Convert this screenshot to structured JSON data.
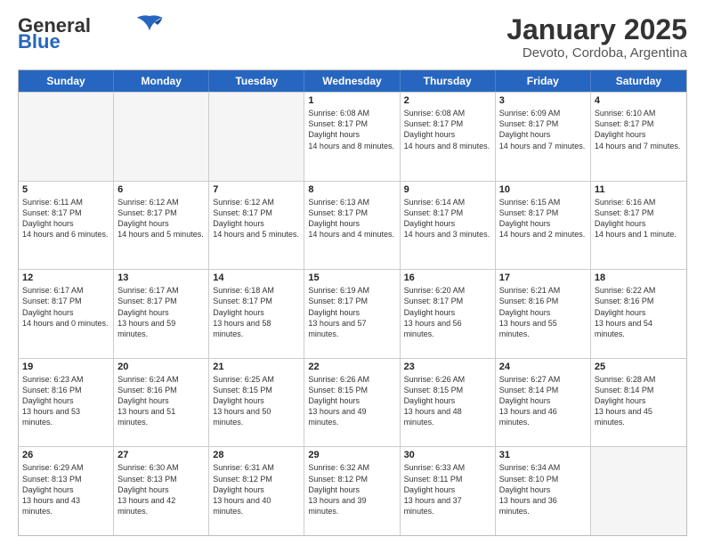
{
  "logo": {
    "text_general": "General",
    "text_blue": "Blue"
  },
  "title": "January 2025",
  "subtitle": "Devoto, Cordoba, Argentina",
  "weekdays": [
    "Sunday",
    "Monday",
    "Tuesday",
    "Wednesday",
    "Thursday",
    "Friday",
    "Saturday"
  ],
  "rows": [
    [
      {
        "day": "",
        "empty": true
      },
      {
        "day": "",
        "empty": true
      },
      {
        "day": "",
        "empty": true
      },
      {
        "day": "1",
        "sunrise": "6:08 AM",
        "sunset": "8:17 PM",
        "daylight": "14 hours and 8 minutes."
      },
      {
        "day": "2",
        "sunrise": "6:08 AM",
        "sunset": "8:17 PM",
        "daylight": "14 hours and 8 minutes."
      },
      {
        "day": "3",
        "sunrise": "6:09 AM",
        "sunset": "8:17 PM",
        "daylight": "14 hours and 7 minutes."
      },
      {
        "day": "4",
        "sunrise": "6:10 AM",
        "sunset": "8:17 PM",
        "daylight": "14 hours and 7 minutes."
      }
    ],
    [
      {
        "day": "5",
        "sunrise": "6:11 AM",
        "sunset": "8:17 PM",
        "daylight": "14 hours and 6 minutes."
      },
      {
        "day": "6",
        "sunrise": "6:12 AM",
        "sunset": "8:17 PM",
        "daylight": "14 hours and 5 minutes."
      },
      {
        "day": "7",
        "sunrise": "6:12 AM",
        "sunset": "8:17 PM",
        "daylight": "14 hours and 5 minutes."
      },
      {
        "day": "8",
        "sunrise": "6:13 AM",
        "sunset": "8:17 PM",
        "daylight": "14 hours and 4 minutes."
      },
      {
        "day": "9",
        "sunrise": "6:14 AM",
        "sunset": "8:17 PM",
        "daylight": "14 hours and 3 minutes."
      },
      {
        "day": "10",
        "sunrise": "6:15 AM",
        "sunset": "8:17 PM",
        "daylight": "14 hours and 2 minutes."
      },
      {
        "day": "11",
        "sunrise": "6:16 AM",
        "sunset": "8:17 PM",
        "daylight": "14 hours and 1 minute."
      }
    ],
    [
      {
        "day": "12",
        "sunrise": "6:17 AM",
        "sunset": "8:17 PM",
        "daylight": "14 hours and 0 minutes."
      },
      {
        "day": "13",
        "sunrise": "6:17 AM",
        "sunset": "8:17 PM",
        "daylight": "13 hours and 59 minutes."
      },
      {
        "day": "14",
        "sunrise": "6:18 AM",
        "sunset": "8:17 PM",
        "daylight": "13 hours and 58 minutes."
      },
      {
        "day": "15",
        "sunrise": "6:19 AM",
        "sunset": "8:17 PM",
        "daylight": "13 hours and 57 minutes."
      },
      {
        "day": "16",
        "sunrise": "6:20 AM",
        "sunset": "8:17 PM",
        "daylight": "13 hours and 56 minutes."
      },
      {
        "day": "17",
        "sunrise": "6:21 AM",
        "sunset": "8:16 PM",
        "daylight": "13 hours and 55 minutes."
      },
      {
        "day": "18",
        "sunrise": "6:22 AM",
        "sunset": "8:16 PM",
        "daylight": "13 hours and 54 minutes."
      }
    ],
    [
      {
        "day": "19",
        "sunrise": "6:23 AM",
        "sunset": "8:16 PM",
        "daylight": "13 hours and 53 minutes."
      },
      {
        "day": "20",
        "sunrise": "6:24 AM",
        "sunset": "8:16 PM",
        "daylight": "13 hours and 51 minutes."
      },
      {
        "day": "21",
        "sunrise": "6:25 AM",
        "sunset": "8:15 PM",
        "daylight": "13 hours and 50 minutes."
      },
      {
        "day": "22",
        "sunrise": "6:26 AM",
        "sunset": "8:15 PM",
        "daylight": "13 hours and 49 minutes."
      },
      {
        "day": "23",
        "sunrise": "6:26 AM",
        "sunset": "8:15 PM",
        "daylight": "13 hours and 48 minutes."
      },
      {
        "day": "24",
        "sunrise": "6:27 AM",
        "sunset": "8:14 PM",
        "daylight": "13 hours and 46 minutes."
      },
      {
        "day": "25",
        "sunrise": "6:28 AM",
        "sunset": "8:14 PM",
        "daylight": "13 hours and 45 minutes."
      }
    ],
    [
      {
        "day": "26",
        "sunrise": "6:29 AM",
        "sunset": "8:13 PM",
        "daylight": "13 hours and 43 minutes."
      },
      {
        "day": "27",
        "sunrise": "6:30 AM",
        "sunset": "8:13 PM",
        "daylight": "13 hours and 42 minutes."
      },
      {
        "day": "28",
        "sunrise": "6:31 AM",
        "sunset": "8:12 PM",
        "daylight": "13 hours and 40 minutes."
      },
      {
        "day": "29",
        "sunrise": "6:32 AM",
        "sunset": "8:12 PM",
        "daylight": "13 hours and 39 minutes."
      },
      {
        "day": "30",
        "sunrise": "6:33 AM",
        "sunset": "8:11 PM",
        "daylight": "13 hours and 37 minutes."
      },
      {
        "day": "31",
        "sunrise": "6:34 AM",
        "sunset": "8:10 PM",
        "daylight": "13 hours and 36 minutes."
      },
      {
        "day": "",
        "empty": true
      }
    ]
  ]
}
